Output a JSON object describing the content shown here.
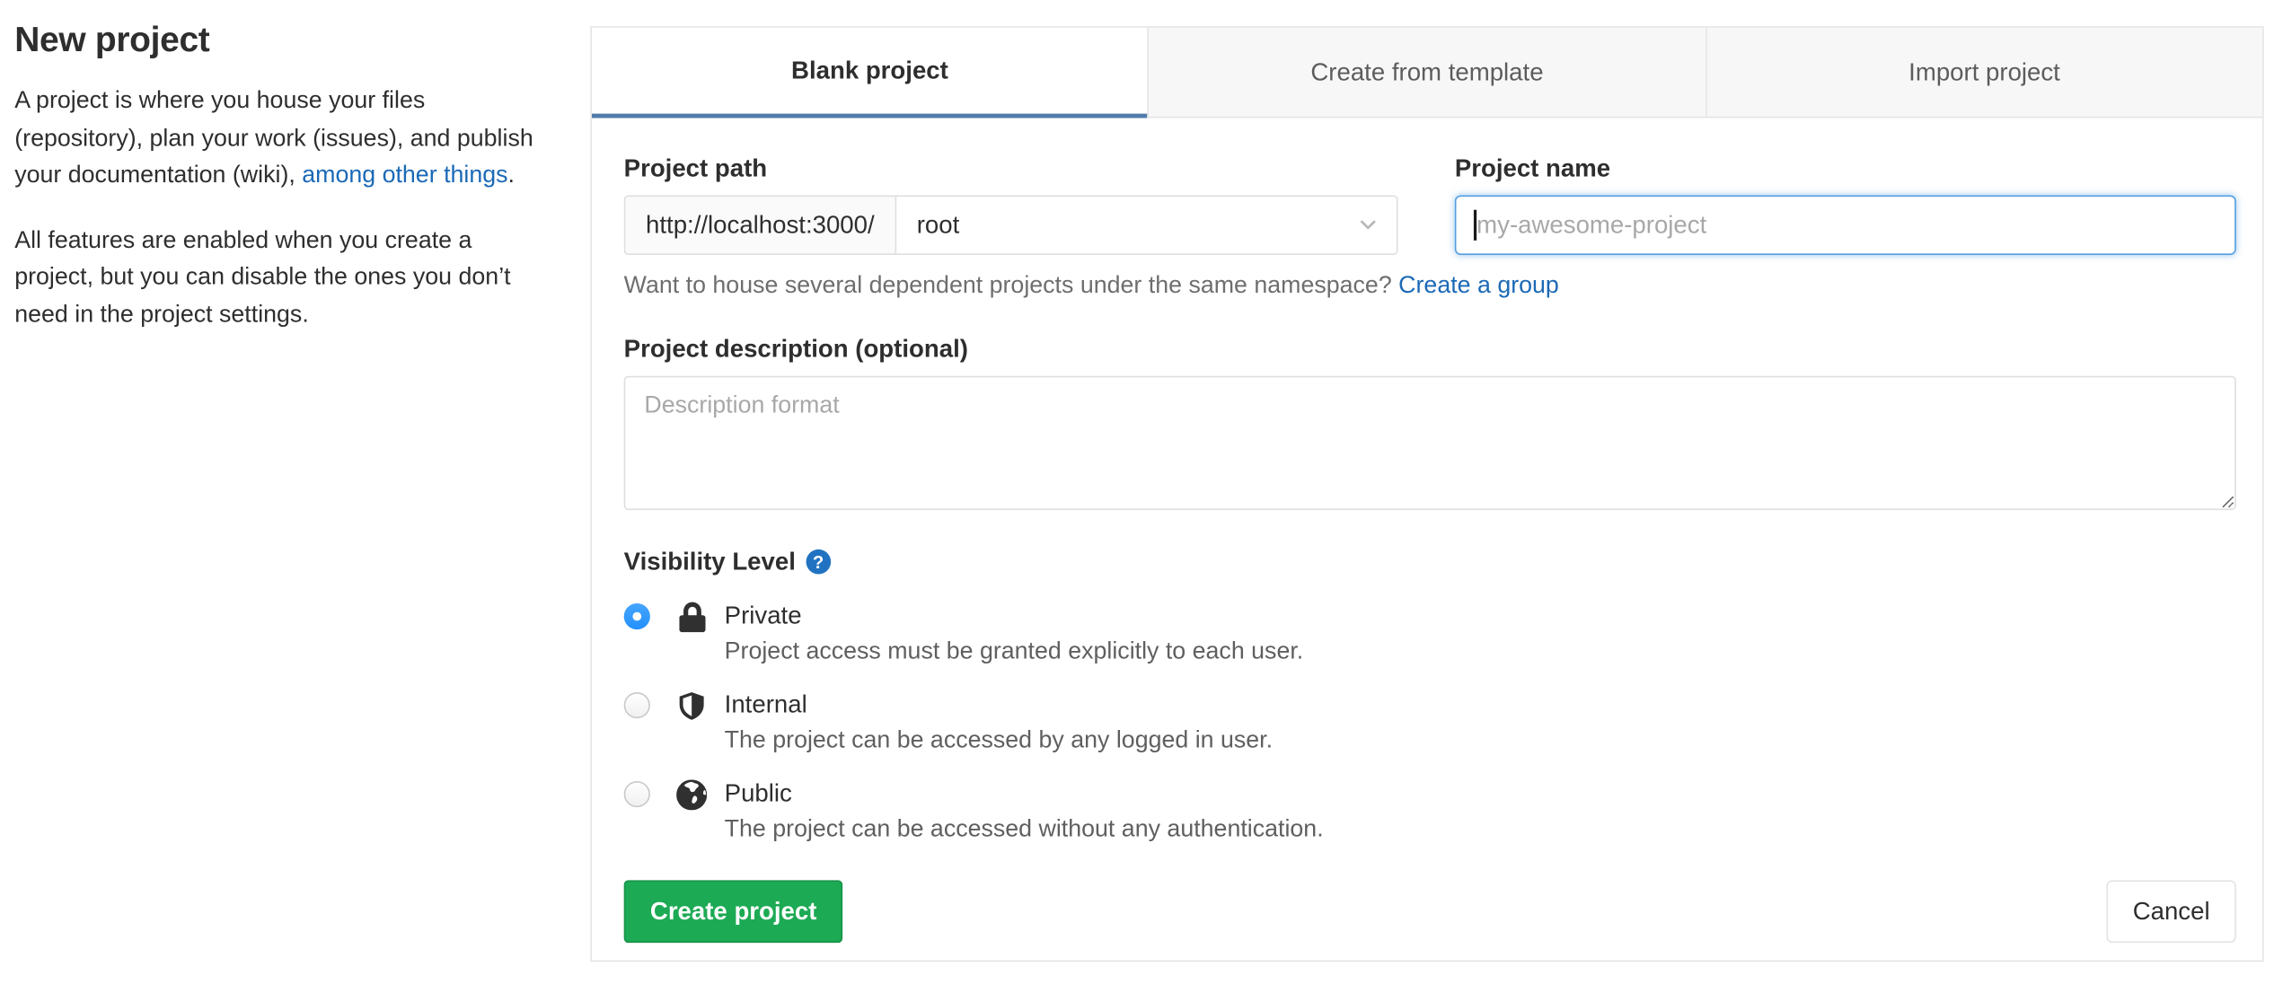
{
  "sidebar": {
    "title": "New project",
    "para1_before": "A project is where you house your files (repository), plan your work (issues), and publish your documentation (wiki), ",
    "para1_link": "among other things",
    "para1_after": ".",
    "para2": "All features are enabled when you create a project, but you can disable the ones you don’t need in the project settings."
  },
  "tabs": [
    {
      "label": "Blank project",
      "active": true
    },
    {
      "label": "Create from template",
      "active": false
    },
    {
      "label": "Import project",
      "active": false
    }
  ],
  "form": {
    "project_path": {
      "label": "Project path",
      "url_prefix": "http://localhost:3000/",
      "namespace_selected": "root"
    },
    "project_name": {
      "label": "Project name",
      "placeholder": "my-awesome-project",
      "value": ""
    },
    "namespace_hint": {
      "text": "Want to house several dependent projects under the same namespace? ",
      "link": "Create a group"
    },
    "description": {
      "label": "Project description (optional)",
      "placeholder": "Description format"
    },
    "visibility": {
      "label": "Visibility Level",
      "help_glyph": "?",
      "help_icon": "question-circle-icon",
      "options": [
        {
          "name": "Private",
          "icon": "lock-icon",
          "selected": true,
          "description": "Project access must be granted explicitly to each user."
        },
        {
          "name": "Internal",
          "icon": "shield-icon",
          "selected": false,
          "description": "The project can be accessed by any logged in user."
        },
        {
          "name": "Public",
          "icon": "globe-icon",
          "selected": false,
          "description": "The project can be accessed without any authentication."
        }
      ]
    },
    "submit_label": "Create project",
    "cancel_label": "Cancel"
  },
  "colors": {
    "accent_tab_underline": "#4f7bab",
    "link_blue": "#1b69b6",
    "radio_selected_blue": "#2f9bfe",
    "create_button_green": "#1caa54",
    "focused_input_border": "#559fe0",
    "panel_border": "#e5e5e5",
    "icon_dark": "#303030"
  }
}
